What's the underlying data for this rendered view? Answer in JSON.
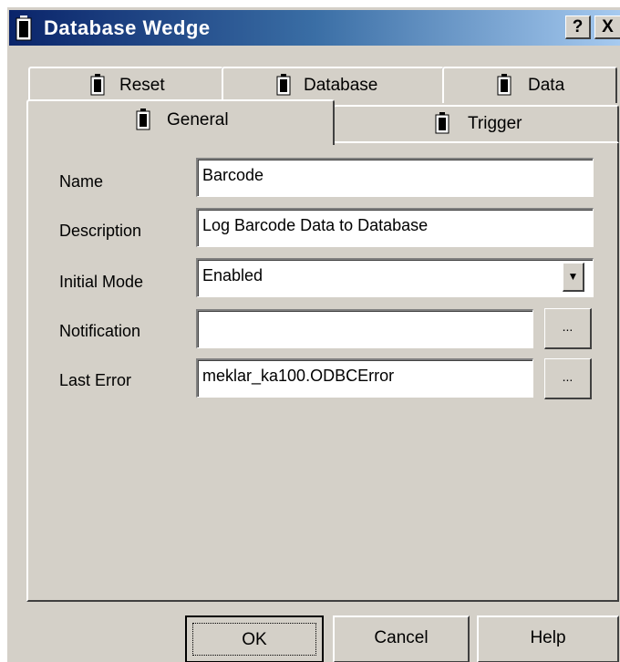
{
  "window": {
    "title": "Database Wedge",
    "help_button": "?",
    "close_button": "X"
  },
  "tabs": {
    "reset": "Reset",
    "database": "Database",
    "data": "Data",
    "general": "General",
    "trigger": "Trigger",
    "active": "General"
  },
  "form": {
    "name_label": "Name",
    "name_value": "Barcode",
    "description_label": "Description",
    "description_value": "Log Barcode Data to Database",
    "initial_mode_label": "Initial Mode",
    "initial_mode_value": "Enabled",
    "notification_label": "Notification",
    "notification_value": "",
    "last_error_label": "Last Error",
    "last_error_value": "meklar_ka100.ODBCError",
    "browse_label": "..."
  },
  "buttons": {
    "ok": "OK",
    "cancel": "Cancel",
    "help": "Help"
  },
  "colors": {
    "face": "#d4d0c8",
    "title_start": "#0a246a",
    "title_end": "#a6caf0"
  },
  "icons": {
    "title": "battery-icon",
    "tab": "battery-icon",
    "dropdown": "chevron-down-icon"
  }
}
